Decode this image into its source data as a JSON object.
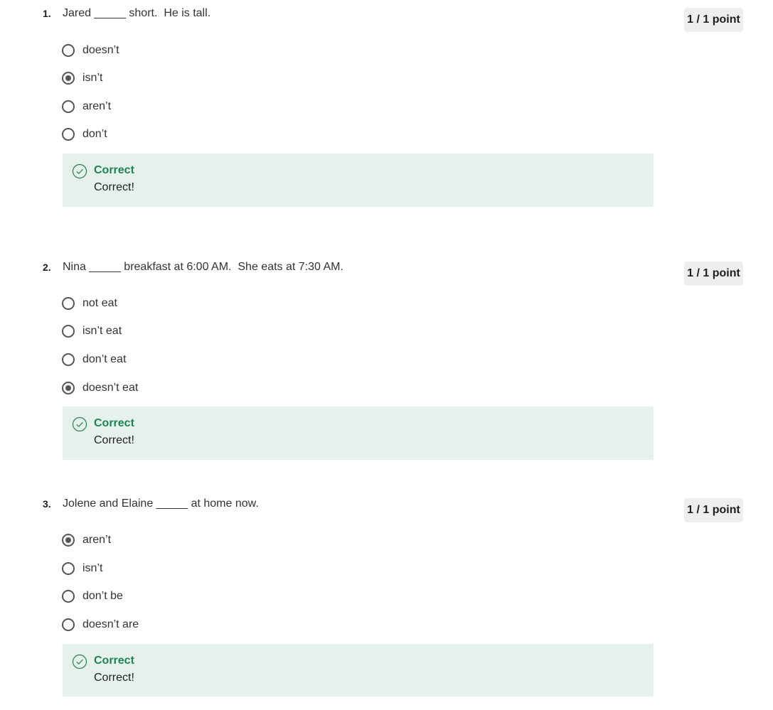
{
  "colors": {
    "correct_text": "#1f8354",
    "feedback_bg": "#e7f1ec",
    "points_badge_bg": "#eeeeee",
    "radio": "#555555"
  },
  "questions": [
    {
      "number": "1.",
      "prompt": "Jared _____ short.  He is tall.",
      "points": "1 / 1 point",
      "options": [
        {
          "label": "doesn’t",
          "selected": false
        },
        {
          "label": "isn’t",
          "selected": true
        },
        {
          "label": "aren’t",
          "selected": false
        },
        {
          "label": "don’t",
          "selected": false
        }
      ],
      "feedback": {
        "icon": "check-circle-icon",
        "title": "Correct",
        "text": "Correct!"
      }
    },
    {
      "number": "2.",
      "prompt": "Nina _____ breakfast at 6:00 AM.  She eats at 7:30 AM.",
      "points": "1 / 1 point",
      "options": [
        {
          "label": "not eat",
          "selected": false
        },
        {
          "label": "isn’t eat",
          "selected": false
        },
        {
          "label": "don’t eat",
          "selected": false
        },
        {
          "label": "doesn’t eat",
          "selected": true
        }
      ],
      "feedback": {
        "icon": "check-circle-icon",
        "title": "Correct",
        "text": "Correct!"
      }
    },
    {
      "number": "3.",
      "prompt": "Jolene and Elaine _____ at home now.",
      "points": "1 / 1 point",
      "options": [
        {
          "label": "aren’t",
          "selected": true
        },
        {
          "label": "isn’t",
          "selected": false
        },
        {
          "label": "don’t be",
          "selected": false
        },
        {
          "label": "doesn’t are",
          "selected": false
        }
      ],
      "feedback": {
        "icon": "check-circle-icon",
        "title": "Correct",
        "text": "Correct!"
      }
    }
  ]
}
